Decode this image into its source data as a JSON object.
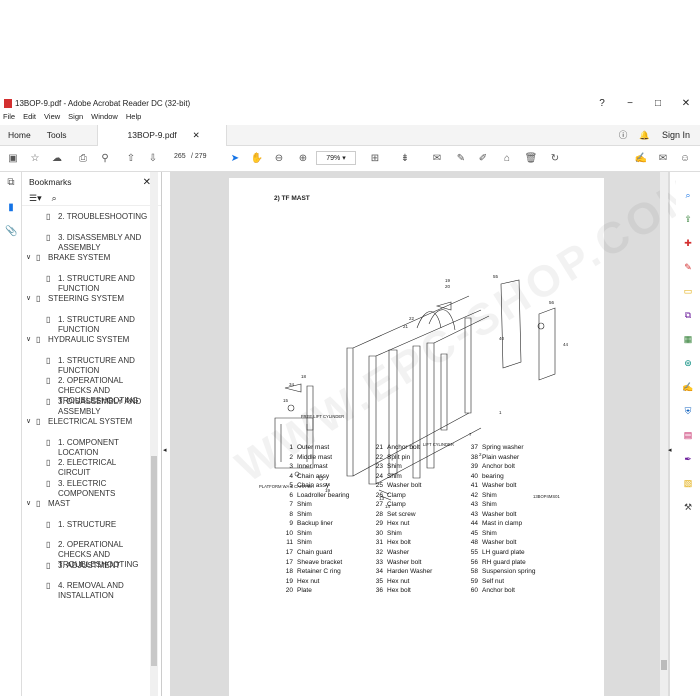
{
  "window": {
    "title": "13BOP-9.pdf - Adobe Acrobat Reader DC (32-bit)",
    "controls": [
      "?",
      "−",
      "□",
      "✕"
    ]
  },
  "menu": [
    "File",
    "Edit",
    "View",
    "Sign",
    "Window",
    "Help"
  ],
  "tabs": {
    "home": "Home",
    "tools": "Tools",
    "doc": "13BOP-9.pdf",
    "sign_in": "Sign In"
  },
  "toolbar": {
    "page_current": "265",
    "page_total": "/ 279",
    "zoom": "79%"
  },
  "bookmarks": {
    "title": "Bookmarks",
    "items": [
      {
        "label": "2. TROUBLESHOOTING",
        "level": 2
      },
      {
        "label": "3. DISASSEMBLY AND ASSEMBLY",
        "level": 2
      },
      {
        "label": "BRAKE SYSTEM",
        "level": 1
      },
      {
        "label": "1. STRUCTURE AND FUNCTION",
        "level": 2
      },
      {
        "label": "STEERING SYSTEM",
        "level": 1
      },
      {
        "label": "1. STRUCTURE AND FUNCTION",
        "level": 2
      },
      {
        "label": "HYDRAULIC SYSTEM",
        "level": 1
      },
      {
        "label": "1. STRUCTURE AND FUNCTION",
        "level": 2
      },
      {
        "label": "2. OPERATIONAL CHECKS AND TROUBLESHOOTING",
        "level": 2
      },
      {
        "label": "3. DISASSEMBLY AND ASSEMBLY",
        "level": 2
      },
      {
        "label": "ELECTRICAL SYSTEM",
        "level": 1
      },
      {
        "label": "1. COMPONENT LOCATION",
        "level": 2
      },
      {
        "label": "2. ELECTRICAL CIRCUIT",
        "level": 2
      },
      {
        "label": "3. ELECTRIC COMPONENTS",
        "level": 2
      },
      {
        "label": "MAST",
        "level": 1
      },
      {
        "label": "1. STRUCTURE",
        "level": 2
      },
      {
        "label": "2. OPERATIONAL CHECKS AND TROUBLESHOOTING",
        "level": 2
      },
      {
        "label": "3. ADJUSTMENT",
        "level": 2
      },
      {
        "label": "4. REMOVAL AND INSTALLATION",
        "level": 2
      }
    ]
  },
  "page": {
    "section_title": "2) TF MAST",
    "watermark": "WWW.EPC-SHOP.COM",
    "diagram_labels": {
      "free_lift_cylinder": "FREE LIFT CYLINDER",
      "lift_cylinder": "LIFT CYLINDER",
      "platform_carriage": "PLATFORM WA & CARR WA",
      "code": "13BOP4MS01"
    },
    "parts_col1": [
      [
        "1",
        "Outer mast"
      ],
      [
        "2",
        "Middle mast"
      ],
      [
        "3",
        "Inner mast"
      ],
      [
        "4",
        "Chain assy"
      ],
      [
        "5",
        "Chain assy"
      ],
      [
        "6",
        "Loadroller bearing"
      ],
      [
        "7",
        "Shim"
      ],
      [
        "8",
        "Shim"
      ],
      [
        "9",
        "Backup liner"
      ],
      [
        "10",
        "Shim"
      ],
      [
        "11",
        "Shim"
      ],
      [
        "17",
        "Chain guard"
      ],
      [
        "17",
        "Sheave bracket"
      ],
      [
        "18",
        "Retainer C ring"
      ],
      [
        "19",
        "Hex nut"
      ],
      [
        "20",
        "Plate"
      ]
    ],
    "parts_col2": [
      [
        "21",
        "Anchor bolt"
      ],
      [
        "22",
        "Split pin"
      ],
      [
        "23",
        "Shim"
      ],
      [
        "24",
        "Shim"
      ],
      [
        "25",
        "Washer bolt"
      ],
      [
        "26",
        "Clamp"
      ],
      [
        "27",
        "Clamp"
      ],
      [
        "28",
        "Set screw"
      ],
      [
        "29",
        "Hex nut"
      ],
      [
        "30",
        "Shim"
      ],
      [
        "31",
        "Hex bolt"
      ],
      [
        "32",
        "Washer"
      ],
      [
        "33",
        "Washer bolt"
      ],
      [
        "34",
        "Harden Washer"
      ],
      [
        "35",
        "Hex nut"
      ],
      [
        "36",
        "Hex bolt"
      ]
    ],
    "parts_col3": [
      [
        "37",
        "Spring washer"
      ],
      [
        "38",
        "Plain washer"
      ],
      [
        "39",
        "Anchor bolt"
      ],
      [
        "40",
        "bearing"
      ],
      [
        "41",
        "Washer bolt"
      ],
      [
        "42",
        "Shim"
      ],
      [
        "43",
        "Shim"
      ],
      [
        "43",
        "Washer bolt"
      ],
      [
        "44",
        "Mast in clamp"
      ],
      [
        "45",
        "Shim"
      ],
      [
        "48",
        "Washer bolt"
      ],
      [
        "55",
        "LH guard plate"
      ],
      [
        "56",
        "RH guard plate"
      ],
      [
        "58",
        "Suspension spring"
      ],
      [
        "59",
        "Self nut"
      ],
      [
        "60",
        "Anchor bolt"
      ]
    ]
  },
  "colors": {
    "accent_blue": "#1473e6",
    "pdf_red": "#d32f2f"
  }
}
